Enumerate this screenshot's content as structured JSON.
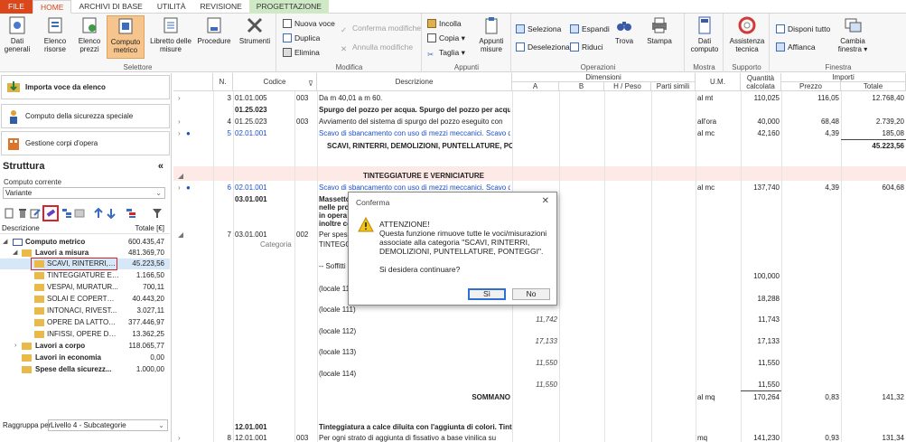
{
  "tabs": [
    "FILE",
    "HOME",
    "ARCHIVI DI BASE",
    "UTILITÀ",
    "REVISIONE",
    "PROGETTAZIONE"
  ],
  "ribbon": {
    "selettore": {
      "label": "Selettore",
      "buttons": [
        "Dati generali",
        "Elenco risorse",
        "Elenco prezzi",
        "Computo metrico",
        "Libretto delle misure",
        "Procedure",
        "Strumenti"
      ]
    },
    "modifica": {
      "label": "Modifica",
      "items": [
        "Nuova voce",
        "Duplica",
        "Elimina",
        "Conferma modifiche",
        "Annulla modifiche"
      ]
    },
    "appunti": {
      "label": "Appunti",
      "items": [
        "Incolla",
        "Copia",
        "Taglia"
      ],
      "big": "Appunti misure"
    },
    "operazioni": {
      "label": "Operazioni",
      "items": [
        "Seleziona",
        "Deseleziona",
        "Espandi",
        "Riduci"
      ],
      "big": [
        "Trova",
        "Stampa"
      ]
    },
    "mostra": {
      "label": "Mostra",
      "big": "Dati computo"
    },
    "supporto": {
      "label": "Supporto",
      "big": "Assistenza tecnica"
    },
    "finestra": {
      "label": "Finestra",
      "items": [
        "Disponi tutto",
        "Affianca"
      ],
      "big": "Cambia finestra"
    }
  },
  "left": {
    "btn_import": "Importa voce da elenco",
    "btn_safety": "Computo della sicurezza speciale",
    "btn_bodies": "Gestione corpi d'opera",
    "struct_title": "Struttura",
    "collapse": "«",
    "computo_label": "Computo corrente",
    "computo_value": "Variante",
    "tree_header_desc": "Descrizione",
    "tree_header_total": "Totale [€]",
    "tree": [
      {
        "label": "Computo metrico",
        "value": "600.435,47",
        "level": 0,
        "bold": true
      },
      {
        "label": "Lavori a misura",
        "value": "481.369,70",
        "level": 1,
        "bold": true
      },
      {
        "label": "SCAVI, RINTERRI, ...",
        "value": "45.223,56",
        "level": 2,
        "bold": false
      },
      {
        "label": "TINTEGGIATURE E ...",
        "value": "1.166,50",
        "level": 2,
        "bold": false
      },
      {
        "label": "VESPAI, MURATUR...",
        "value": "700,11",
        "level": 2,
        "bold": false
      },
      {
        "label": "SOLAI E COPERTURE",
        "value": "40.443,20",
        "level": 2,
        "bold": false
      },
      {
        "label": "INTONACI, RIVEST...",
        "value": "3.027,11",
        "level": 2,
        "bold": false
      },
      {
        "label": "OPERE DA LATTON...",
        "value": "377.446,97",
        "level": 2,
        "bold": false
      },
      {
        "label": "INFISSI, OPERE DA...",
        "value": "13.362,25",
        "level": 2,
        "bold": false
      },
      {
        "label": "Lavori a corpo",
        "value": "118.065,77",
        "level": 1,
        "bold": true
      },
      {
        "label": "Lavori in economia",
        "value": "0,00",
        "level": 1,
        "bold": true
      },
      {
        "label": "Spese della sicurezz...",
        "value": "1.000,00",
        "level": 1,
        "bold": true
      }
    ],
    "group_by_label": "Raggruppa per",
    "group_by_value": "Livello 4 - Subcategorie"
  },
  "grid": {
    "headers": {
      "n": "N.",
      "codice": "Codice",
      "descrizione": "Descrizione",
      "dimensioni": "Dimensioni",
      "a": "A",
      "b": "B",
      "hpeso": "H / Peso",
      "parti": "Parti simili",
      "um": "U.M.",
      "quantita": "Quantità calcolata",
      "importi": "Importi",
      "prezzo": "Prezzo",
      "totale": "Totale"
    },
    "rows": [
      {
        "n": "3",
        "code": "01.01.005",
        "x": "003",
        "desc": "Da m 40,01 a m 60.",
        "um": "al mt",
        "q": "110,025",
        "p": "116,05",
        "t": "12.768,40"
      },
      {
        "code": "01.25.023",
        "desc": "Spurgo del pozzo per acqua. Spurgo del pozzo per acqua da"
      },
      {
        "n": "4",
        "code": "01.25.023",
        "x": "003",
        "desc": "Avviamento del sistema di spurgo del pozzo eseguito con",
        "um": "all'ora",
        "q": "40,000",
        "p": "68,48",
        "t": "2.739,20"
      },
      {
        "n": "5",
        "code": "02.01.001",
        "desc": "Scavo di sbancamento con uso di mezzi meccanici. Scavo di",
        "um": "al mc",
        "q": "42,160",
        "p": "4,39",
        "t": "185,08"
      },
      {
        "desc": "SCAVI, RINTERRI, DEMOLIZIONI, PUNTELLATURE, PONTEGGI",
        "t": "45.223,56"
      },
      {
        "desc": "TINTEGGIATURE E VERNICIATURE"
      },
      {
        "n": "6",
        "code": "02.01.001",
        "desc": "Scavo di sbancamento con uso di mezzi meccanici. Scavo di",
        "um": "al mc",
        "q": "137,740",
        "p": "4,39",
        "t": "604,68"
      },
      {
        "code": "03.01.001",
        "desc": "Massetto c"
      },
      {
        "desc": "nelle propo"
      },
      {
        "desc": "in opera be"
      },
      {
        "desc": "inoltre con"
      },
      {
        "n": "7",
        "code": "03.01.001",
        "x": "002",
        "desc": "Per spess"
      },
      {
        "code": "Categoria",
        "desc": "TINTEGGI"
      },
      {
        "desc": "-- Soffitti"
      },
      {
        "desc": "(locale 11",
        "q": "100,000"
      },
      {
        "q": "18,288"
      },
      {
        "desc": "(locale 111)",
        "a": "11,742",
        "q": "11,743"
      },
      {
        "desc": "(locale 112)",
        "a": "17,133",
        "q": "17,133"
      },
      {
        "desc": "(locale 113)",
        "a": "11,550",
        "q": "11,550"
      },
      {
        "desc": "(locale 114)",
        "a": "11,550",
        "q": "11,550"
      },
      {
        "desc": "SOMMANO",
        "um": "al mq",
        "q": "170,264",
        "p": "0,83",
        "t": "141,32"
      },
      {
        "code": "12.01.001",
        "desc": "Tinteggiatura a calce diluita con l'aggiunta di colori. Tinteggiatura"
      },
      {
        "n": "8",
        "code": "12.01.001",
        "x": "003",
        "desc": "Per ogni strato di aggiunta di fissativo a base vinilica su",
        "um": "mq",
        "q": "141,230",
        "p": "0,93",
        "t": "131,34"
      }
    ]
  },
  "dialog": {
    "title": "Conferma",
    "close": "✕",
    "heading": "ATTENZIONE!",
    "message": "Questa funzione rimuove tutte le voci/misurazioni associate alla categoria \"SCAVI, RINTERRI, DEMOLIZIONI, PUNTELLATURE, PONTEGGI\".",
    "question": "Si desidera continuare?",
    "yes": "Sì",
    "no": "No"
  }
}
